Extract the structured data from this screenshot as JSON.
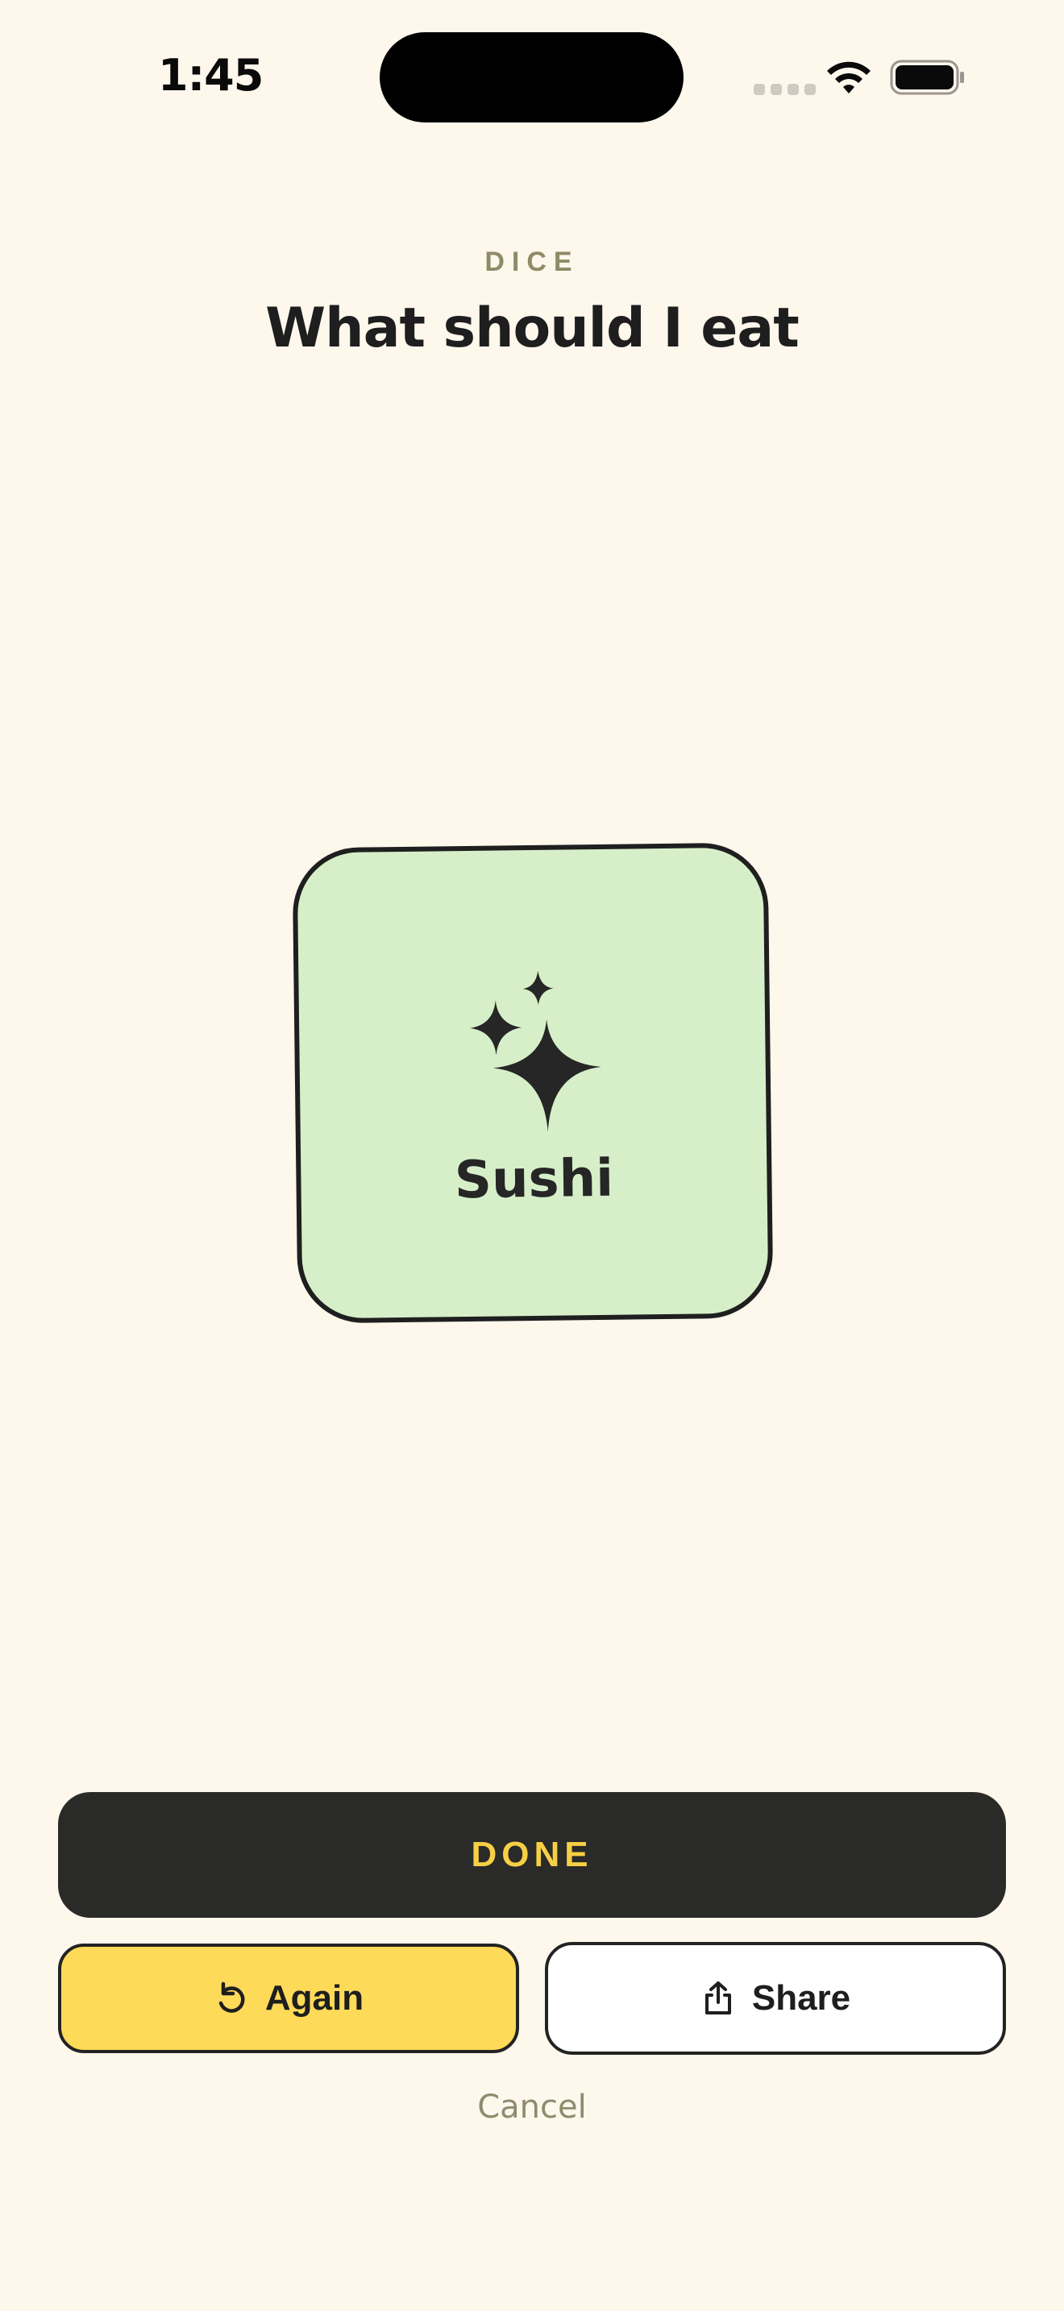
{
  "status_bar": {
    "time": "1:45",
    "icons": [
      "cell-signal-icon",
      "wifi-icon",
      "battery-icon"
    ]
  },
  "header": {
    "eyebrow": "DICE",
    "title": "What should I eat"
  },
  "result": {
    "icon": "sparkles-icon",
    "label": "Sushi",
    "card_color": "#D6EFC9"
  },
  "actions": {
    "done_label": "DONE",
    "again_label": "Again",
    "again_icon": "rotate-left-icon",
    "share_label": "Share",
    "share_icon": "share-icon",
    "cancel_label": "Cancel"
  },
  "colors": {
    "background": "#FEF7EC",
    "accent_yellow": "#FEDA59",
    "done_text": "#F6CF45",
    "dark": "#2A2A28",
    "muted_text": "#8E8B67"
  }
}
